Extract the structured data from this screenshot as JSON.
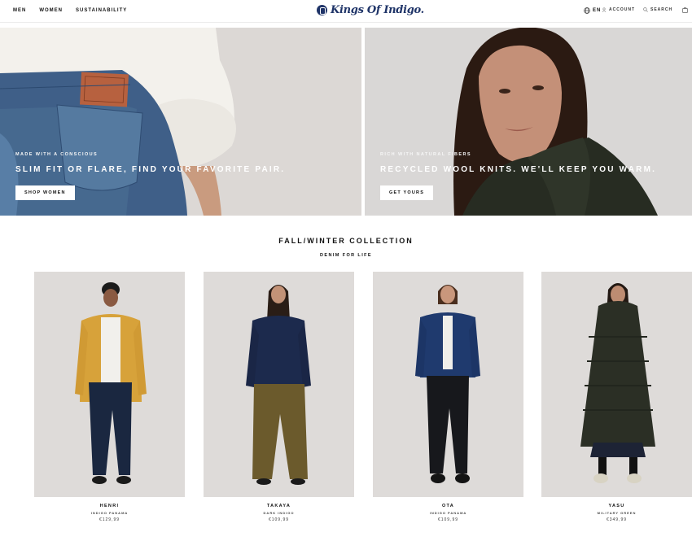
{
  "header": {
    "nav_left": [
      "MEN",
      "WOMEN",
      "SUSTAINABILITY"
    ],
    "logo_text": "Kings Of Indigo.",
    "language": "EN",
    "account_label": "ACCOUNT",
    "search_label": "SEARCH"
  },
  "hero": {
    "left": {
      "eyebrow": "MADE WITH A CONSCIOUS",
      "headline": "SLIM FIT OR FLARE, FIND YOUR FAVORITE PAIR.",
      "button_label": "SHOP WOMEN"
    },
    "right": {
      "eyebrow": "RICH WITH NATURAL FIBERS",
      "headline": "RECYCLED WOOL KNITS. WE'LL KEEP YOU WARM.",
      "button_label": "GET YOURS"
    }
  },
  "collection": {
    "title": "FALL/WINTER COLLECTION",
    "subtitle": "DENIM FOR LIFE"
  },
  "products": [
    {
      "name": "HENRI",
      "color": "INDIGO PANAMA",
      "price": "€129,99"
    },
    {
      "name": "TAKAYA",
      "color": "DARK INDIGO",
      "price": "€109,99"
    },
    {
      "name": "OTA",
      "color": "INDIGO PANAMA",
      "price": "€109,99"
    },
    {
      "name": "YASU",
      "color": "MILITARY GREEN",
      "price": "€349,99"
    }
  ],
  "colors": {
    "brand": "#1f3468",
    "background": "#ffffff",
    "hero_bg": "#ddd9d6"
  }
}
